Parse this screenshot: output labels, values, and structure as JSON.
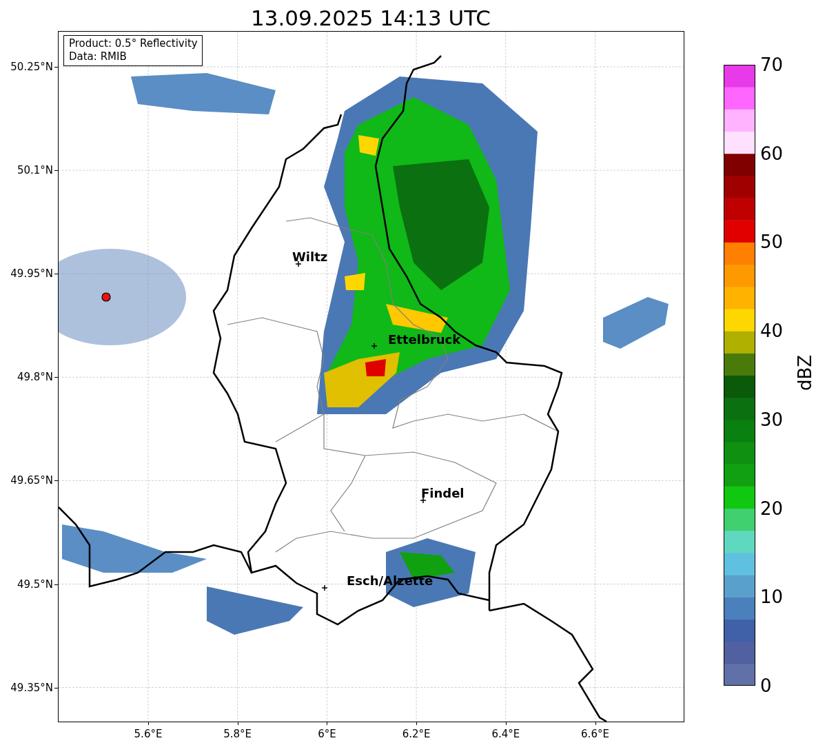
{
  "title": "13.09.2025 14:13 UTC",
  "info_box": [
    "Product: 0.5° Reflectivity",
    "Data: RMIB"
  ],
  "map": {
    "y_ticks": [
      "50.25°N",
      "50.1°N",
      "49.95°N",
      "49.8°N",
      "49.65°N",
      "49.5°N",
      "49.35°N"
    ],
    "x_ticks": [
      "5.6°E",
      "5.8°E",
      "6°E",
      "6.2°E",
      "6.4°E",
      "6.6°E"
    ],
    "cities": [
      {
        "name": "Wiltz"
      },
      {
        "name": "Ettelbruck"
      },
      {
        "name": "Findel"
      },
      {
        "name": "Esch/Alzette"
      }
    ]
  },
  "colorbar": {
    "label": "dBZ",
    "ticks": [
      "70",
      "60",
      "50",
      "40",
      "30",
      "20",
      "10",
      "0"
    ]
  }
}
